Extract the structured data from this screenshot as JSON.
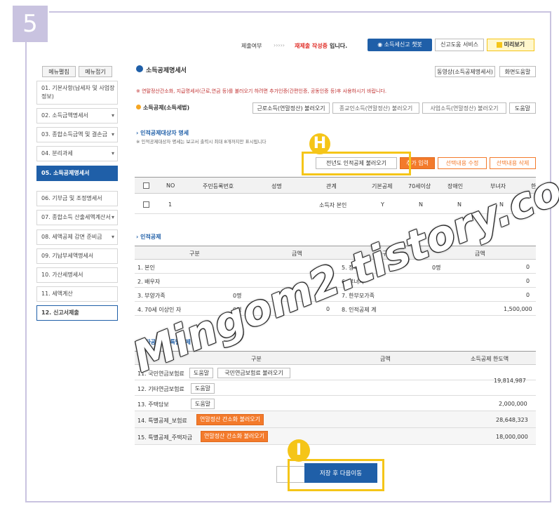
{
  "step_number": "5",
  "top_bar": {
    "status_label": "제출여부",
    "arrows": "›››››",
    "status_value": "재제출 작성중",
    "status_suffix": "입니다.",
    "chatbot_label": "소득세신고 챗봇",
    "help_service_label": "신고도움 서비스",
    "preview_label": "미리보기"
  },
  "sidebar": {
    "expand_all": "메뉴펼침",
    "collapse_all": "메뉴접기",
    "items": [
      {
        "label": "01. 기본사항(납세자 및 사업장정보)",
        "chevron": false
      },
      {
        "label": "02. 소득금액명세서",
        "chevron": true
      },
      {
        "label": "03. 종합소득금액 및 결손금",
        "chevron": true
      },
      {
        "label": "04. 분리과세",
        "chevron": true
      },
      {
        "label": "05. 소득공제명세서",
        "chevron": false
      },
      {
        "label": "06. 기부금 및 조정명세서",
        "chevron": false
      },
      {
        "label": "07. 종합소득 산출세액계산서",
        "chevron": true
      },
      {
        "label": "08. 세액공제 감면 준비금",
        "chevron": true
      },
      {
        "label": "09. 기납부세액명세서",
        "chevron": false
      },
      {
        "label": "10. 가산세명세서",
        "chevron": false
      },
      {
        "label": "11. 세액계산",
        "chevron": false
      },
      {
        "label": "12. 신고서제출",
        "chevron": false
      }
    ]
  },
  "main": {
    "title": "소득공제명세서",
    "video_btn": "동영상(소득공제명세서)",
    "screen_help_btn": "화면도움말",
    "notice": "※ 연말정산간소화, 지급명세서(근로,연금 등)를 불러오기 하려면 추가인증(간편인증, 공동인증 등)후 사용하시기 바랍니다.",
    "section_label": "소득공제(소득세법)",
    "load_btns": [
      "근로소득(연말정산) 불러오기",
      "종교인소득(연말정산) 불러오기",
      "사업소득(연말정산) 불러오기",
      "도움말"
    ],
    "target_title": "› 인적공제대상자 명세",
    "target_note": "※ 인적공제대상자 명세는 보고서 출력시 최대 8개까지만 표시됩니다",
    "prev_year_btn": "전년도 인적공제 불러오기",
    "add_btn": "추가 입력",
    "modify_btn": "선택내용 수정",
    "delete_btn": "선택내용 삭제",
    "person_table": {
      "headers": [
        "NO",
        "주민등록번호",
        "성명",
        "관계",
        "기본공제",
        "70세이상",
        "장애인",
        "부녀자",
        "한"
      ],
      "rows": [
        [
          "1",
          "",
          "",
          "소득자 본인",
          "Y",
          "N",
          "N",
          "N",
          ""
        ]
      ]
    },
    "personal_title": "› 인적공제",
    "personal_table": {
      "headers": [
        "구분",
        "금액",
        "구분",
        "금액"
      ],
      "rows": [
        [
          "1. 본인",
          "",
          "5. 장애인",
          "0명",
          "0"
        ],
        [
          "2. 배우자",
          "0",
          "6. 부녀자",
          "",
          "0"
        ],
        [
          "3. 부양가족",
          "0명",
          "0",
          "7. 한부모가족",
          "0"
        ],
        [
          "4. 70세 이상인 자",
          "0명",
          "0",
          "8. 인적공제 계",
          "1,500,000"
        ]
      ]
    },
    "other_title": "› 기타공제 및 특별공제",
    "other_table": {
      "headers": [
        "구분",
        "금액",
        "소득공제 한도액"
      ],
      "rows": [
        {
          "label": "11. 국민연금보험료",
          "btns": [
            "도움말",
            "국민연금보험료 불러오기"
          ],
          "amount": ""
        },
        {
          "label": "12. 기타연금보험료",
          "btns": [
            "도움말"
          ],
          "amount": "19,814,987"
        },
        {
          "label": "13. 주택담보",
          "btns": [
            "도움말"
          ],
          "amount": "2,000,000"
        },
        {
          "label": "14. 특별공제_보험료",
          "btns": [
            "연말정산 간소화 불러오기"
          ],
          "amount": "28,648,323"
        },
        {
          "label": "15. 특별공제_주택자금",
          "btns": [
            "연말정산 간소화 불러오기"
          ],
          "amount": "18,000,000"
        }
      ]
    },
    "save_next_btn": "저장 후 다음이동"
  },
  "annotations": {
    "h": "H",
    "i": "I"
  },
  "watermark": "Mingom2.tistory.com"
}
